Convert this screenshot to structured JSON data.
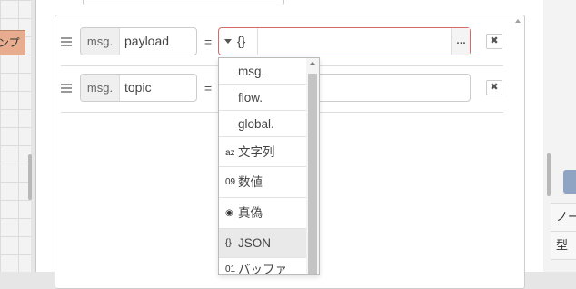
{
  "workspace": {
    "node_label": "ンプ"
  },
  "rules": [
    {
      "prefix": "msg.",
      "value": "payload",
      "operator": "=",
      "target_label": "{}",
      "target_more": "…",
      "delete": "✖"
    },
    {
      "prefix": "msg.",
      "value": "topic",
      "operator": "=",
      "delete": "✖"
    }
  ],
  "dropdown": {
    "items": [
      {
        "icon": "",
        "label": "msg."
      },
      {
        "icon": "",
        "label": "flow."
      },
      {
        "icon": "",
        "label": "global."
      },
      {
        "icon": "az",
        "label": "文字列"
      },
      {
        "icon": "09",
        "label": "数値"
      },
      {
        "icon": "◉",
        "label": "真偽"
      },
      {
        "icon": "{}",
        "label": "JSON"
      },
      {
        "icon": "01",
        "label": "バッファ"
      }
    ],
    "selected": "JSON"
  },
  "sidebar": {
    "rows": [
      "ノー",
      "型"
    ]
  }
}
